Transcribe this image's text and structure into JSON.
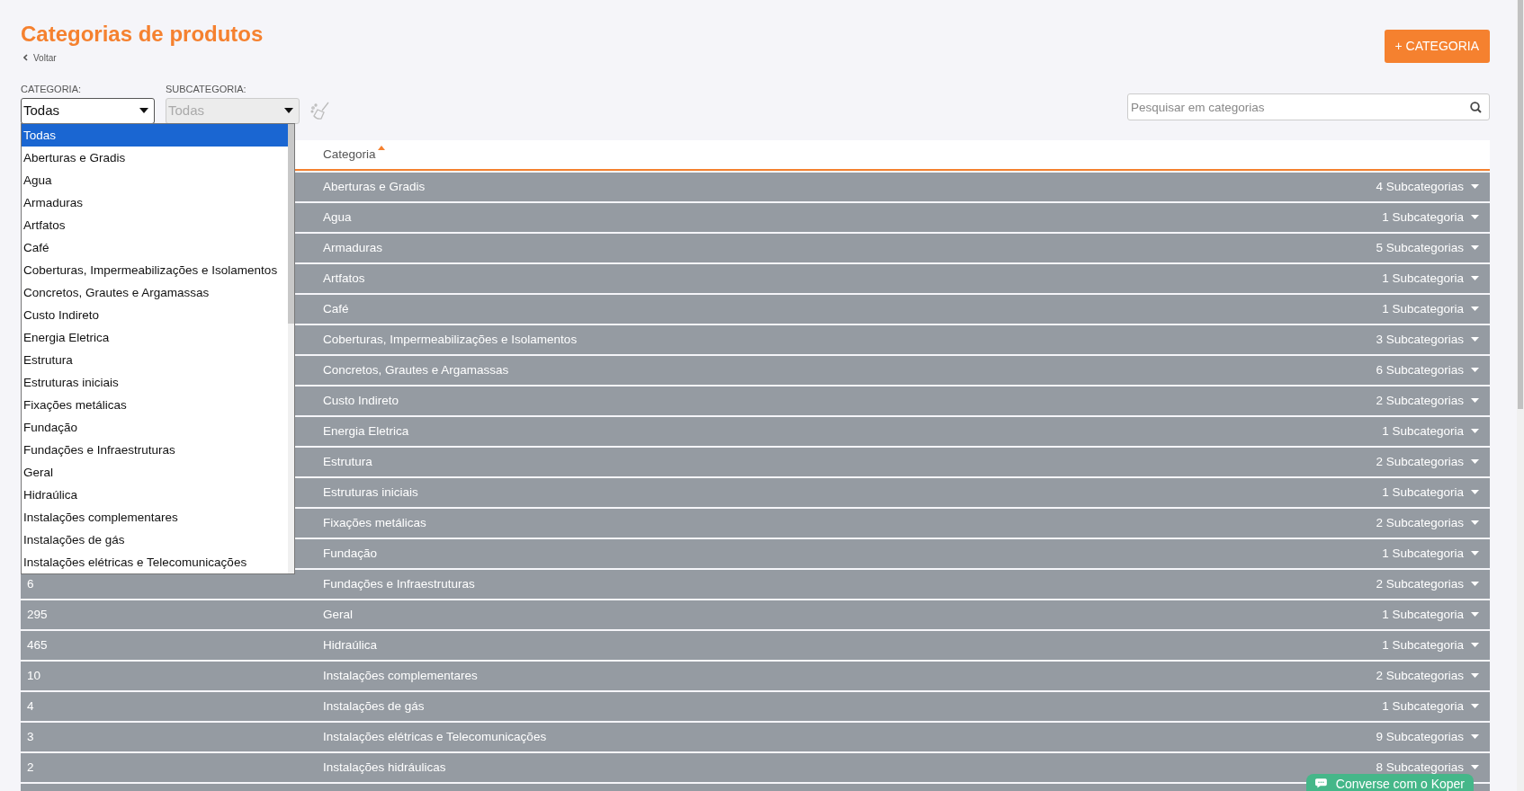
{
  "page": {
    "title": "Categorias de produtos",
    "back_link": "Voltar"
  },
  "add_button": {
    "label": "+ CATEGORIA"
  },
  "filters": [
    {
      "label": "CATEGORIA:",
      "value": "Todas",
      "disabled": false,
      "expanded": true
    },
    {
      "label": "SUBCATEGORIA:",
      "value": "Todas",
      "disabled": true,
      "expanded": false
    }
  ],
  "dropdown": {
    "options": [
      {
        "label": "Todas",
        "selected": true
      },
      {
        "label": "Aberturas e Gradis",
        "selected": false
      },
      {
        "label": "Agua",
        "selected": false
      },
      {
        "label": "Armaduras",
        "selected": false
      },
      {
        "label": "Artfatos",
        "selected": false
      },
      {
        "label": "Café",
        "selected": false
      },
      {
        "label": "Coberturas, Impermeabilizações e Isolamentos",
        "selected": false
      },
      {
        "label": "Concretos, Grautes e Argamassas",
        "selected": false
      },
      {
        "label": "Custo Indireto",
        "selected": false
      },
      {
        "label": "Energia Eletrica",
        "selected": false
      },
      {
        "label": "Estrutura",
        "selected": false
      },
      {
        "label": "Estruturas iniciais",
        "selected": false
      },
      {
        "label": "Fixações metálicas",
        "selected": false
      },
      {
        "label": "Fundação",
        "selected": false
      },
      {
        "label": "Fundações e Infraestruturas",
        "selected": false
      },
      {
        "label": "Geral",
        "selected": false
      },
      {
        "label": "Hidraúlica",
        "selected": false
      },
      {
        "label": "Instalações complementares",
        "selected": false
      },
      {
        "label": "Instalações de gás",
        "selected": false
      },
      {
        "label": "Instalações elétricas e Telecomunicações",
        "selected": false
      }
    ]
  },
  "search": {
    "placeholder": "Pesquisar em categorias"
  },
  "table": {
    "columns": [
      {
        "label": "Categoria",
        "sort_ascending": true
      }
    ],
    "rows": [
      {
        "category": "Aberturas e Gradis",
        "subcategories": "4 Subcategorias"
      },
      {
        "category": "Agua",
        "subcategories": "1 Subcategoria"
      },
      {
        "category": "Armaduras",
        "subcategories": "5 Subcategorias"
      },
      {
        "category": "Artfatos",
        "subcategories": "1 Subcategoria"
      },
      {
        "category": "Café",
        "subcategories": "1 Subcategoria"
      },
      {
        "category": "Coberturas, Impermeabilizações e Isolamentos",
        "subcategories": "3 Subcategorias"
      },
      {
        "category": "Concretos, Grautes e Argamassas",
        "subcategories": "6 Subcategorias"
      },
      {
        "category": "Custo Indireto",
        "subcategories": "2 Subcategorias"
      },
      {
        "category": "Energia Eletrica",
        "subcategories": "1 Subcategoria"
      },
      {
        "category": "Estrutura",
        "subcategories": "2 Subcategorias"
      },
      {
        "category": "Estruturas iniciais",
        "subcategories": "1 Subcategoria"
      },
      {
        "category": "Fixações metálicas",
        "subcategories": "2 Subcategorias"
      },
      {
        "category": "Fundação",
        "subcategories": "1 Subcategoria"
      },
      {
        "count": "6",
        "category": "Fundações e Infraestruturas",
        "subcategories": "2 Subcategorias"
      },
      {
        "count": "295",
        "category": "Geral",
        "subcategories": "1 Subcategoria"
      },
      {
        "count": "465",
        "category": "Hidraúlica",
        "subcategories": "1 Subcategoria"
      },
      {
        "count": "10",
        "category": "Instalações complementares",
        "subcategories": "2 Subcategorias"
      },
      {
        "count": "4",
        "category": "Instalações de gás",
        "subcategories": "1 Subcategoria"
      },
      {
        "count": "3",
        "category": "Instalações elétricas e Telecomunicações",
        "subcategories": "9 Subcategorias"
      },
      {
        "count": "2",
        "category": "Instalações hidráulicas",
        "subcategories": "8 Subcategorias"
      },
      {}
    ]
  },
  "chat": {
    "label": "Converse com o Koper"
  }
}
